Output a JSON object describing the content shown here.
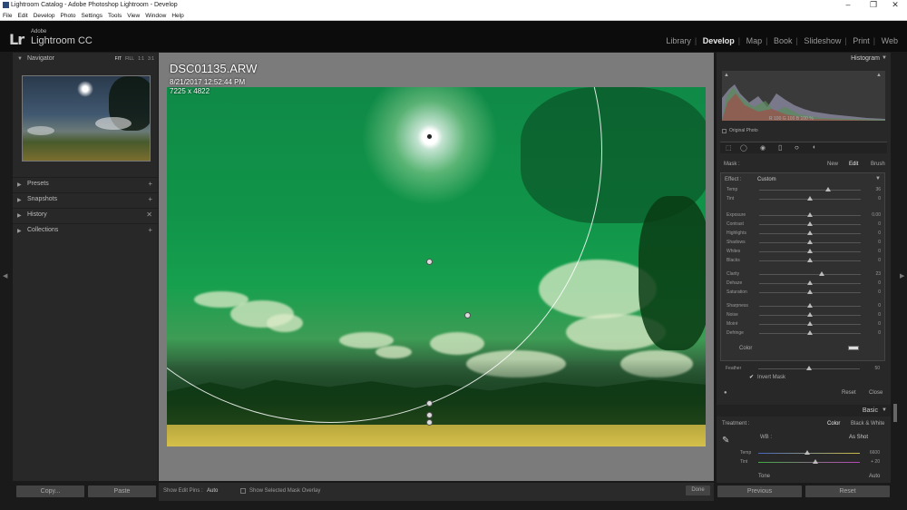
{
  "window": {
    "title": "Lightroom Catalog - Adobe Photoshop Lightroom - Develop",
    "controls": [
      "–",
      "❐",
      "✕"
    ]
  },
  "menu": [
    "File",
    "Edit",
    "Develop",
    "Photo",
    "Settings",
    "Tools",
    "View",
    "Window",
    "Help"
  ],
  "identity": {
    "logo": "Lr",
    "adobe": "Adobe",
    "product": "Lightroom CC"
  },
  "modules": [
    {
      "label": "Library",
      "active": false
    },
    {
      "label": "Develop",
      "active": true
    },
    {
      "label": "Map",
      "active": false
    },
    {
      "label": "Book",
      "active": false
    },
    {
      "label": "Slideshow",
      "active": false
    },
    {
      "label": "Print",
      "active": false
    },
    {
      "label": "Web",
      "active": false
    }
  ],
  "left": {
    "navigator": {
      "title": "Navigator",
      "zoom": [
        "FIT",
        "FILL",
        "1:1",
        "3:1"
      ]
    },
    "panels": [
      {
        "label": "Presets",
        "action": "+"
      },
      {
        "label": "Snapshots",
        "action": "+"
      },
      {
        "label": "History",
        "action": "✕"
      },
      {
        "label": "Collections",
        "action": "+"
      }
    ],
    "copy": "Copy...",
    "paste": "Paste"
  },
  "image": {
    "filename": "DSC01135.ARW",
    "datetime": "8/21/2017 12:52:44 PM",
    "dimensions": "7225 x 4822"
  },
  "toolbar": {
    "edit_pins_label": "Show Edit Pins :",
    "edit_pins_value": "Auto",
    "mask_overlay_label": "Show Selected Mask Overlay",
    "done": "Done"
  },
  "right": {
    "histogram_title": "Histogram",
    "histo_readout": {
      "r_label": "R",
      "r": "100",
      "g_label": "G",
      "g": "100",
      "b_label": "B",
      "b": "100",
      "pct": "%"
    },
    "original_photo": "Original Photo",
    "mask": {
      "label": "Mask :",
      "new": "New",
      "edit": "Edit",
      "brush": "Brush"
    },
    "effect": {
      "label": "Effect :",
      "value": "Custom"
    },
    "sliders_a": [
      {
        "label": "Temp",
        "value": "36",
        "pos": 0.68
      },
      {
        "label": "Tint",
        "value": "0",
        "pos": 0.5
      }
    ],
    "sliders_b": [
      {
        "label": "Exposure",
        "value": "0.00",
        "pos": 0.5
      },
      {
        "label": "Contrast",
        "value": "0",
        "pos": 0.5
      },
      {
        "label": "Highlights",
        "value": "0",
        "pos": 0.5
      },
      {
        "label": "Shadows",
        "value": "0",
        "pos": 0.5
      },
      {
        "label": "Whites",
        "value": "0",
        "pos": 0.5
      },
      {
        "label": "Blacks",
        "value": "0",
        "pos": 0.5
      }
    ],
    "sliders_c": [
      {
        "label": "Clarity",
        "value": "23",
        "pos": 0.62
      },
      {
        "label": "Dehaze",
        "value": "0",
        "pos": 0.5
      },
      {
        "label": "Saturation",
        "value": "0",
        "pos": 0.5
      }
    ],
    "sliders_d": [
      {
        "label": "Sharpness",
        "value": "0",
        "pos": 0.5
      },
      {
        "label": "Noise",
        "value": "0",
        "pos": 0.5
      },
      {
        "label": "Moiré",
        "value": "0",
        "pos": 0.5
      },
      {
        "label": "Defringe",
        "value": "0",
        "pos": 0.5
      }
    ],
    "color_label": "Color",
    "feather": {
      "label": "Feather",
      "value": "50",
      "pos": 0.5
    },
    "invert_mask": "Invert Mask",
    "reset": "Reset",
    "close": "Close",
    "basic_title": "Basic",
    "treatment": {
      "label": "Treatment :",
      "color": "Color",
      "bw": "Black & White"
    },
    "wb": {
      "label": "WB :",
      "value": "As Shot"
    },
    "temp": {
      "label": "Temp",
      "value": "6600",
      "pos": 0.48
    },
    "tint": {
      "label": "Tint",
      "value": "+ 20",
      "pos": 0.56
    },
    "tone": {
      "label": "Tone",
      "auto": "Auto"
    },
    "previous": "Previous",
    "reset_all": "Reset"
  }
}
